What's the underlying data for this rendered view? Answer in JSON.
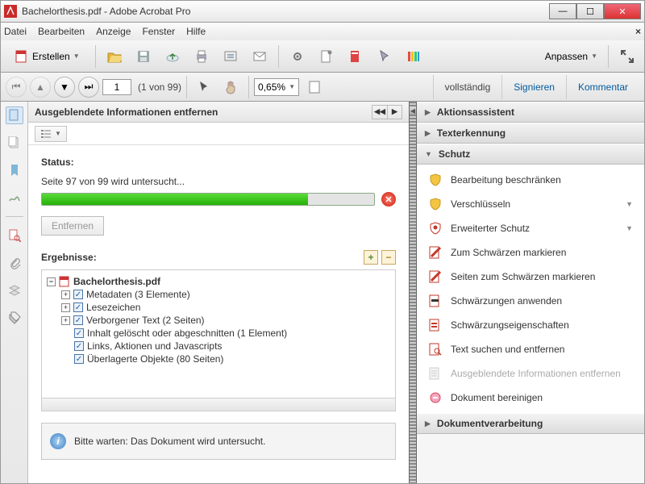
{
  "window": {
    "title": "Bachelorthesis.pdf - Adobe Acrobat Pro"
  },
  "menu": {
    "datei": "Datei",
    "bearbeiten": "Bearbeiten",
    "anzeige": "Anzeige",
    "fenster": "Fenster",
    "hilfe": "Hilfe"
  },
  "toolbar": {
    "create": "Erstellen",
    "anpassen": "Anpassen"
  },
  "nav": {
    "page": "1",
    "pagecount": "(1 von 99)",
    "zoom": "0,65%"
  },
  "rtabs": {
    "voll": "vollständig",
    "sign": "Signieren",
    "komm": "Kommentar"
  },
  "pane": {
    "title": "Ausgeblendete Informationen entfernen",
    "status_label": "Status:",
    "status_msg": "Seite 97 von 99 wird untersucht...",
    "remove": "Entfernen",
    "results_label": "Ergebnisse:",
    "root": "Bachelorthesis.pdf",
    "items": [
      "Metadaten (3 Elemente)",
      "Lesezeichen",
      "Verborgener Text (2 Seiten)",
      "Inhalt gelöscht oder abgeschnitten (1 Element)",
      "Links, Aktionen und Javascripts",
      "Überlagerte Objekte (80 Seiten)"
    ],
    "info": "Bitte warten: Das Dokument wird untersucht."
  },
  "right": {
    "sections": {
      "aktions": "Aktionsassistent",
      "texterk": "Texterkennung",
      "schutz": "Schutz",
      "dokver": "Dokumentverarbeitung"
    },
    "schutz_items": [
      "Bearbeitung beschränken",
      "Verschlüsseln",
      "Erweiterter Schutz",
      "Zum Schwärzen markieren",
      "Seiten zum Schwärzen markieren",
      "Schwärzungen anwenden",
      "Schwärzungseigenschaften",
      "Text suchen und entfernen",
      "Ausgeblendete Informationen entfernen",
      "Dokument bereinigen"
    ]
  }
}
